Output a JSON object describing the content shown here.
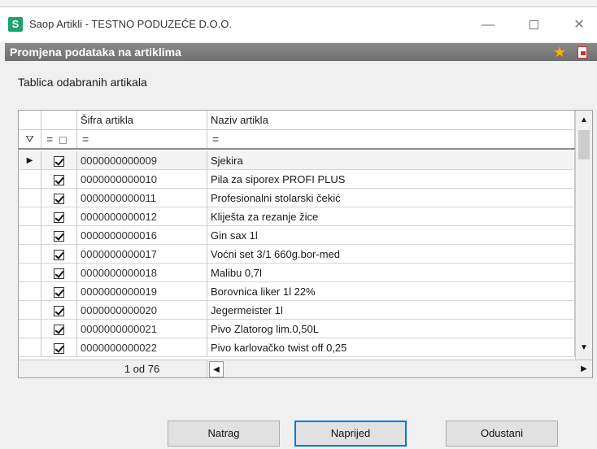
{
  "window": {
    "logo": "S",
    "title": "Saop Artikli - TESTNO PODUZEĆE D.O.O.",
    "min": "—",
    "close": "✕"
  },
  "header": {
    "title": "Promjena podataka na artiklima"
  },
  "section": {
    "label": "Tablica odabranih artikala"
  },
  "grid": {
    "columns": [
      "Šifra artikla",
      "Naziv artikla"
    ],
    "filter": {
      "icon": "⛛",
      "chk_op": "=",
      "code_op": "=",
      "name_op": "="
    },
    "rows": [
      {
        "code": "0000000000009",
        "name": "Sjekira"
      },
      {
        "code": "0000000000010",
        "name": "Pila za siporex PROFI PLUS"
      },
      {
        "code": "0000000000011",
        "name": "Profesionalni stolarski čekić"
      },
      {
        "code": "0000000000012",
        "name": "Kliješta za rezanje žice"
      },
      {
        "code": "0000000000016",
        "name": "Gin sax 1l"
      },
      {
        "code": "0000000000017",
        "name": "Voćni set 3/1 660g.bor-med"
      },
      {
        "code": "0000000000018",
        "name": "Malibu 0,7l"
      },
      {
        "code": "0000000000019",
        "name": "Borovnica liker 1l 22%"
      },
      {
        "code": "0000000000020",
        "name": "Jegermeister 1l"
      },
      {
        "code": "0000000000021",
        "name": "Pivo Zlatorog lim.0,50L"
      },
      {
        "code": "0000000000022",
        "name": "Pivo karlovačko twist off 0,25"
      }
    ],
    "pager": "1 od 76"
  },
  "buttons": {
    "back": "Natrag",
    "next": "Naprijed",
    "cancel": "Odustani"
  }
}
